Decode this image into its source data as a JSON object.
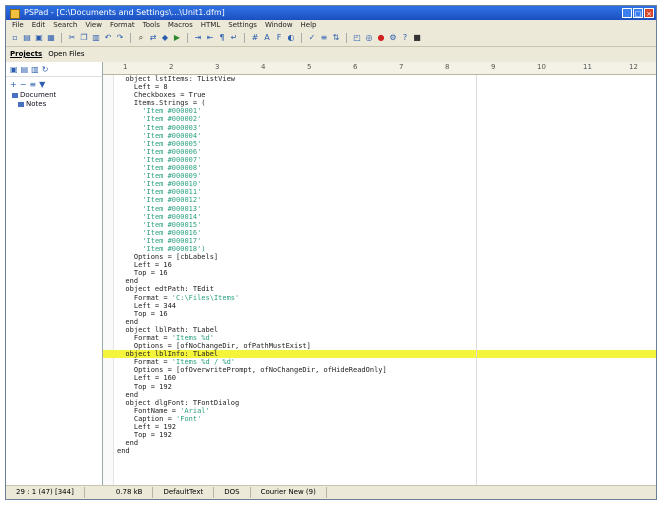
{
  "window": {
    "title": "PSPad - [C:\\Documents and Settings\\...\\Unit1.dfm]"
  },
  "menu": [
    "File",
    "Edit",
    "Search",
    "View",
    "Format",
    "Tools",
    "Macros",
    "HTML",
    "Settings",
    "Window",
    "Help"
  ],
  "project": {
    "tabs": [
      "Projects",
      "Open Files"
    ],
    "tree": [
      {
        "label": "Document",
        "level": 0
      },
      {
        "label": "Notes",
        "level": 1
      }
    ]
  },
  "ruler": {
    "marks": [
      "1",
      "2",
      "3",
      "4",
      "5",
      "6",
      "7",
      "8",
      "9",
      "10",
      "11",
      "12"
    ]
  },
  "editor": {
    "highlight_line_index": 34,
    "lines": [
      "  object lstItems: TListView",
      "    Left = 8",
      "    Checkboxes = True",
      "    Items.Strings = (",
      "      'Item #000001'",
      "      'Item #000002'",
      "      'Item #000003'",
      "      'Item #000004'",
      "      'Item #000005'",
      "      'Item #000006'",
      "      'Item #000007'",
      "      'Item #000008'",
      "      'Item #000009'",
      "      'Item #000010'",
      "      'Item #000011'",
      "      'Item #000012'",
      "      'Item #000013'",
      "      'Item #000014'",
      "      'Item #000015'",
      "      'Item #000016'",
      "      'Item #000017'",
      "      'Item #000018')",
      "    Options = [cbLabels]",
      "    Left = 16",
      "    Top = 16",
      "  end",
      "  object edtPath: TEdit",
      "    Format = 'C:\\Files\\Items'",
      "    Left = 344",
      "    Top = 16",
      "  end",
      "  object lblPath: TLabel",
      "    Format = 'Items %d'",
      "    Options = [ofNoChangeDir, ofPathMustExist]",
      "  object lblInfo: TLabel",
      "    Format = 'Items %d / %d'",
      "    Options = [ofOverwritePrompt, ofNoChangeDir, ofHideReadOnly]",
      "    Left = 160",
      "    Top = 192",
      "  end",
      "  object dlgFont: TFontDialog",
      "    FontName = 'Arial'",
      "    Caption = 'Font'",
      "    Left = 192",
      "    Top = 192",
      "  end",
      "end"
    ]
  },
  "status": [
    "29 : 1 (47) [344]",
    "",
    "0.78 kB",
    "DefaultText",
    "DOS",
    "Courier New (9)"
  ]
}
